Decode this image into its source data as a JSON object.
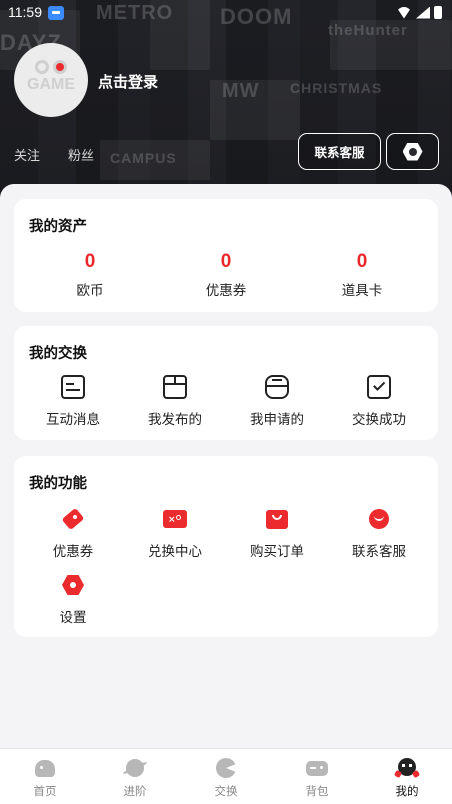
{
  "status_bar": {
    "time": "11:59"
  },
  "profile": {
    "avatar_text": "GAME",
    "login_text": "点击登录",
    "follow_label": "关注",
    "fans_label": "粉丝",
    "service_button": "联系客服",
    "settings_icon": "hexagon-settings-icon"
  },
  "assets": {
    "title": "我的资产",
    "items": [
      {
        "value": "0",
        "label": "欧币"
      },
      {
        "value": "0",
        "label": "优惠券"
      },
      {
        "value": "0",
        "label": "道具卡"
      }
    ],
    "accent": "#e8282b"
  },
  "exchange": {
    "title": "我的交换",
    "items": [
      {
        "label": "互动消息",
        "icon": "message-icon"
      },
      {
        "label": "我发布的",
        "icon": "box-icon"
      },
      {
        "label": "我申请的",
        "icon": "package-icon"
      },
      {
        "label": "交换成功",
        "icon": "check-box-icon"
      }
    ]
  },
  "functions": {
    "title": "我的功能",
    "items": [
      {
        "label": "优惠券",
        "icon": "coupon-tag-icon"
      },
      {
        "label": "兑换中心",
        "icon": "exchange-ticket-icon"
      },
      {
        "label": "购买订单",
        "icon": "shopping-bag-icon"
      },
      {
        "label": "联系客服",
        "icon": "support-face-icon"
      },
      {
        "label": "设置",
        "icon": "settings-hexagon-icon"
      }
    ],
    "accent": "#ec2b2e"
  },
  "bottom_nav": {
    "tabs": [
      {
        "label": "首页",
        "icon": "home-icon",
        "active": false
      },
      {
        "label": "进阶",
        "icon": "planet-icon",
        "active": false
      },
      {
        "label": "交换",
        "icon": "pacman-icon",
        "active": false
      },
      {
        "label": "背包",
        "icon": "gamepad-icon",
        "active": false
      },
      {
        "label": "我的",
        "icon": "mascot-icon",
        "active": true
      }
    ]
  }
}
